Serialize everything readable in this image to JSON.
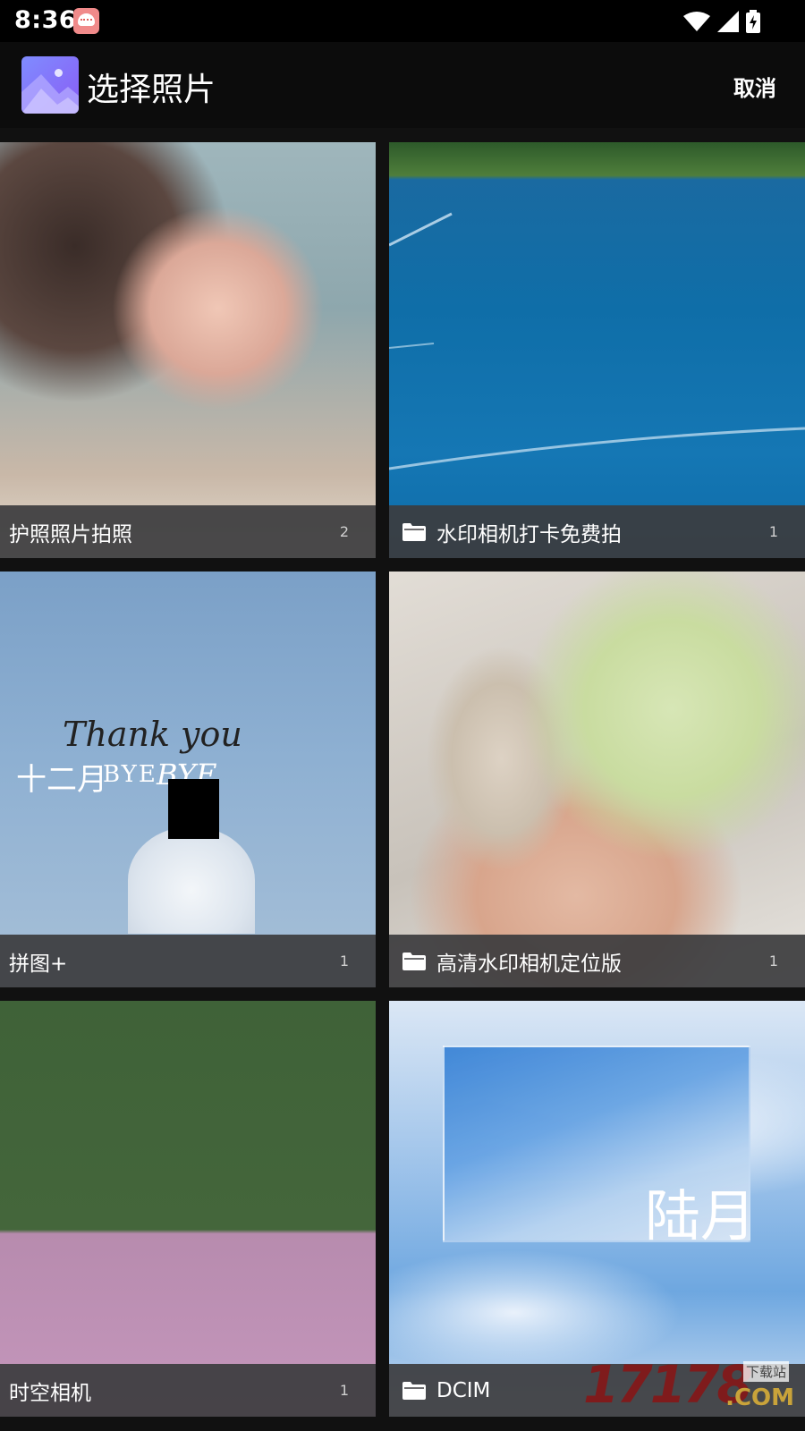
{
  "status_bar": {
    "time": "8:36",
    "icons": [
      "app-notification-icon",
      "wifi-icon",
      "signal-icon",
      "battery-charging-icon"
    ]
  },
  "toolbar": {
    "title": "选择照片",
    "cancel_label": "取消",
    "logo_icon": "gallery-icon"
  },
  "albums": [
    {
      "name": "护照照片拍照",
      "count": "2",
      "has_folder_icon": false
    },
    {
      "name": "水印相机打卡免费拍",
      "count": "1",
      "has_folder_icon": true
    },
    {
      "name": "拼图+",
      "count": "1",
      "has_folder_icon": false
    },
    {
      "name": "高清水印相机定位版",
      "count": "1",
      "has_folder_icon": true
    },
    {
      "name": "时空相机",
      "count": "1",
      "has_folder_icon": false
    },
    {
      "name": "DCIM",
      "count": "",
      "has_folder_icon": true
    }
  ],
  "thumb_text": {
    "thank_you": "Thank you",
    "month": "十二月",
    "bye_1": "BYE",
    "bye_2": "BYE",
    "liu_yue": "陆月"
  },
  "watermark": {
    "digits": "17178",
    "dotcom": ".COM",
    "label": "下载站"
  },
  "colors": {
    "background": "#111111",
    "toolbar": "#0c0c0c",
    "caption_bar": "#3c3c3e",
    "logo_gradient_start": "#7f8cff",
    "logo_gradient_end": "#8a5cf5"
  }
}
